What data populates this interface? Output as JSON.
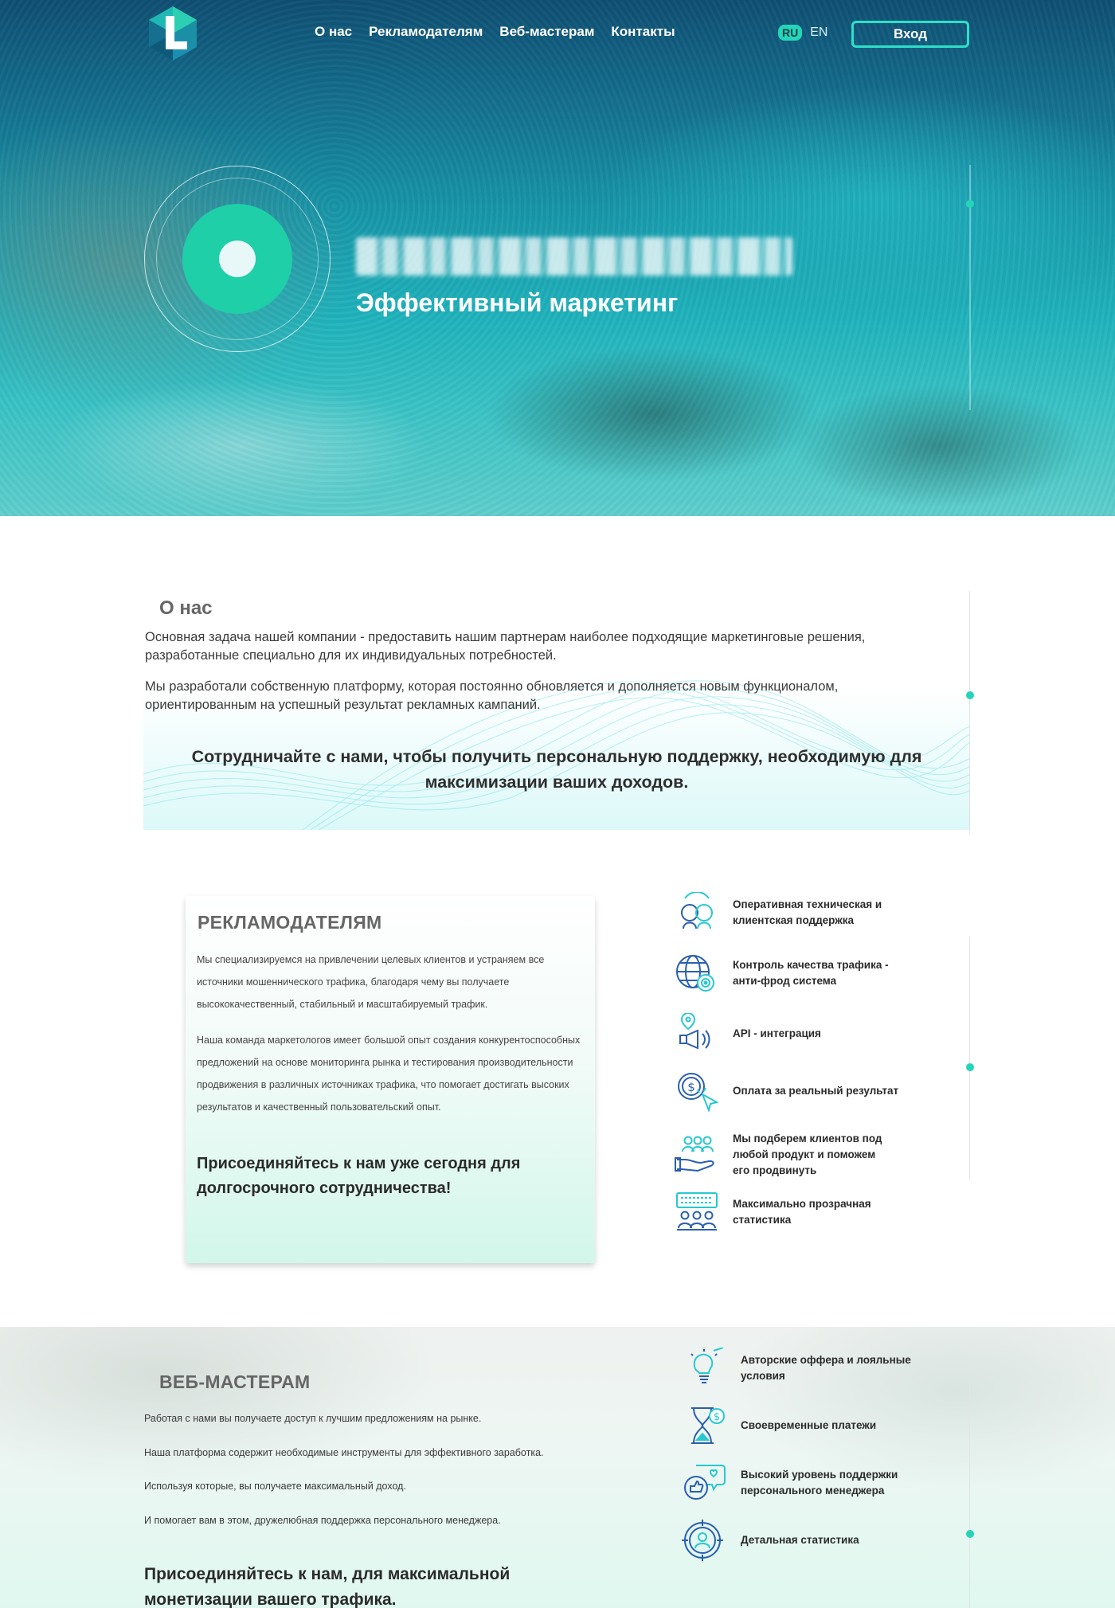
{
  "header": {
    "nav": [
      "О нас",
      "Рекламодателям",
      "Веб-мастерам",
      "Контакты"
    ],
    "lang_active": "RU",
    "lang_other": "EN",
    "login_label": "Вход"
  },
  "hero": {
    "subtitle": "Эффективный маркетинг"
  },
  "about": {
    "title": "О нас",
    "p1": "Основная задача нашей компании - предоставить нашим партнерам наиболее подходящие маркетинговые решения, разработанные специально для их индивидуальных потребностей.",
    "p2": "Мы разработали собственную платформу, которая постоянно обновляется и дополняется новым функционалом, ориентированным на успешный результат рекламных кампаний.",
    "cta": "Сотрудничайте с нами, чтобы получить персональную поддержку, необходимую для максимизации ваших доходов."
  },
  "advertisers": {
    "title": "РЕКЛАМОДАТЕЛЯМ",
    "p1": "Мы специализируемся на привлечении целевых клиентов и устраняем все источники мошеннического трафика, благодаря чему вы получаете высококачественный, стабильный и масштабируемый трафик.",
    "p2": "Наша команда маркетологов имеет большой опыт создания конкурентоспособных предложений на основе мониторинга рынка и тестирования производительности продвижения в различных источниках трафика, что помогает достигать высоких результатов и качественный пользовательский опыт.",
    "cta": "Присоединяйтесь к нам уже сегодня для долгосрочного сотрудничества!",
    "features": [
      {
        "icon": "support-headset-icon",
        "text": "Оперативная техническая и клиентская поддержка"
      },
      {
        "icon": "globe-target-icon",
        "text": "Контроль качества трафика - анти-фрод система"
      },
      {
        "icon": "megaphone-pin-icon",
        "text": "API - интеграция"
      },
      {
        "icon": "coin-cursor-icon",
        "text": "Оплата за реальный результат"
      },
      {
        "icon": "clients-hand-icon",
        "text": "Мы подберем клиентов под любой продукт и поможем его продвинуть"
      },
      {
        "icon": "statistics-board-icon",
        "text": "Максимально прозрачная статистика"
      }
    ]
  },
  "webmasters": {
    "title": "ВЕБ-МАСТЕРАМ",
    "p1": "Работая с нами вы получаете доступ к лучшим предложениям на рынке.",
    "p2": "Наша платформа содержит необходимые инструменты для эффективного заработка.",
    "p3": "Используя которые, вы получаете максимальный доход.",
    "p4": "И помогает вам в этом, дружелюбная поддержка персонального менеджера.",
    "cta": "Присоединяйтесь к нам, для максимальной монетизации вашего трафика.",
    "features": [
      {
        "icon": "lightbulb-icon",
        "text": "Авторские оффера и лояльные условия"
      },
      {
        "icon": "hourglass-dollar-icon",
        "text": "Своевременные платежи"
      },
      {
        "icon": "chat-heart-icon",
        "text": "Высокий уровень поддержки персонального менеджера"
      },
      {
        "icon": "target-user-icon",
        "text": "Детальная статистика"
      }
    ]
  },
  "colors": {
    "accent": "#26d4b8",
    "hero_dark": "#0f4f73",
    "hero_light": "#3cc4c6",
    "icon_blue": "#2a5fb0"
  }
}
